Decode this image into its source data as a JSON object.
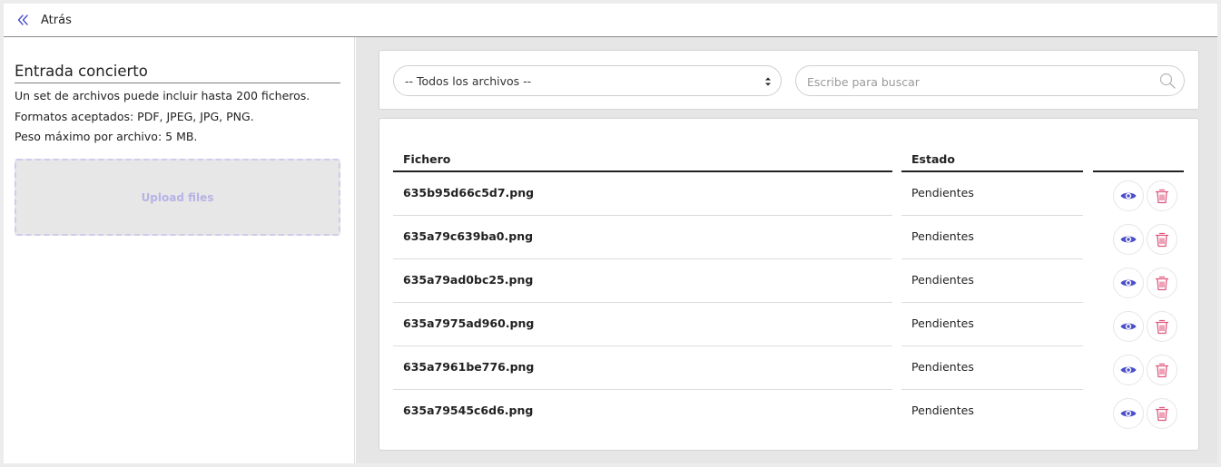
{
  "nav": {
    "back_label": "Atrás"
  },
  "left": {
    "title": "Entrada concierto",
    "info": [
      "Un set de archivos puede incluir hasta 200 ficheros.",
      "Formatos aceptados: PDF, JPEG, JPG, PNG.",
      "Peso máximo por archivo: 5 MB."
    ],
    "upload_label": "Upload files"
  },
  "filters": {
    "select_value": "-- Todos los archivos --",
    "search_placeholder": "Escribe para buscar"
  },
  "table": {
    "columns": [
      "Fichero",
      "Estado"
    ],
    "rows": [
      {
        "file": "635b95d66c5d7.png",
        "status": "Pendientes"
      },
      {
        "file": "635a79c639ba0.png",
        "status": "Pendientes"
      },
      {
        "file": "635a79ad0bc25.png",
        "status": "Pendientes"
      },
      {
        "file": "635a7975ad960.png",
        "status": "Pendientes"
      },
      {
        "file": "635a7961be776.png",
        "status": "Pendientes"
      },
      {
        "file": "635a79545c6d6.png",
        "status": "Pendientes"
      }
    ]
  },
  "icons": {
    "back": "chevron-double-left-icon",
    "select": "select-arrows-icon",
    "search": "search-icon",
    "view": "eye-icon",
    "delete": "trash-icon"
  },
  "colors": {
    "accent": "#4a4fc9",
    "danger": "#e0577f",
    "upload_text": "#b6b3e6",
    "dropzone_bg": "#e7e7e7"
  }
}
